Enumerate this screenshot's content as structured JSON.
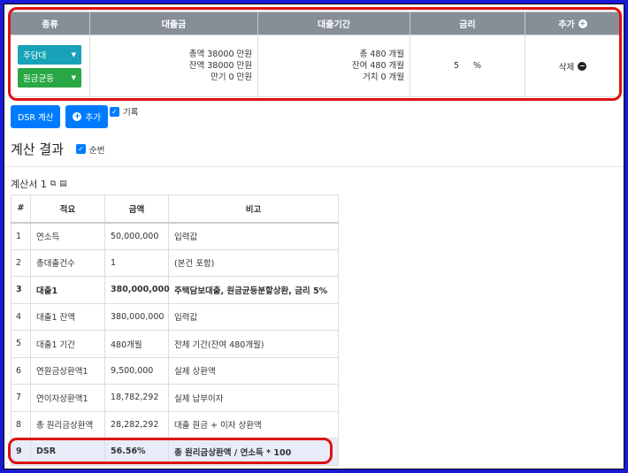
{
  "form": {
    "headers": {
      "type": "종류",
      "amount": "대출금",
      "term": "대출기간",
      "rate": "금리",
      "add": "추가"
    },
    "loan_type": "주담대",
    "repay_type": "원금균등",
    "amount_total": "총액 38000 만원",
    "amount_balance": "잔액 38000 만원",
    "amount_maturity": "만기 0 만원",
    "term_total": "총 480 개월",
    "term_remaining": "잔여 480 개월",
    "term_grace": "거치 0 개월",
    "rate_value": "5",
    "rate_unit": "%",
    "delete_label": "삭제"
  },
  "actions": {
    "dsr_label": "DSR 계산",
    "add_label": "추가",
    "record_label": "기록"
  },
  "section": {
    "title": "계산 결과",
    "order_label": "순번"
  },
  "calc_title": "계산서 1",
  "result": {
    "headers": [
      "#",
      "적요",
      "금액",
      "비고"
    ],
    "rows": [
      [
        "1",
        "연소득",
        "50,000,000",
        "입력값"
      ],
      [
        "2",
        "총대출건수",
        "1",
        "(본건 포함)"
      ],
      [
        "3",
        "대출1",
        "380,000,000",
        "주택담보대출, 원금균등분할상환, 금리 5%"
      ],
      [
        "4",
        "대출1 잔액",
        "380,000,000",
        "입력값"
      ],
      [
        "5",
        "대출1 기간",
        "480개월",
        "전체 기간(잔여 480개월)"
      ],
      [
        "6",
        "연원금상환액1",
        "9,500,000",
        "실제 상환액"
      ],
      [
        "7",
        "연이자상환액1",
        "18,782,292",
        "실제 납부이자"
      ],
      [
        "8",
        "총 원리금상환액",
        "28,282,292",
        "대출 원금 + 이자 상환액"
      ],
      [
        "9",
        "DSR",
        "56.56%",
        "총 원리금상환액 / 연소득 * 100"
      ]
    ]
  },
  "colors": {
    "frame": "#1a1ad6",
    "highlight": "#d11111",
    "primary": "#007bff",
    "teal": "#17a2b8",
    "green": "#28a745",
    "header_gray": "#868e96"
  },
  "icons": [
    "plus-circle-icon",
    "minus-circle-icon",
    "caret-down-icon",
    "checkbox-checked-icon",
    "copy-icon",
    "document-icon"
  ]
}
